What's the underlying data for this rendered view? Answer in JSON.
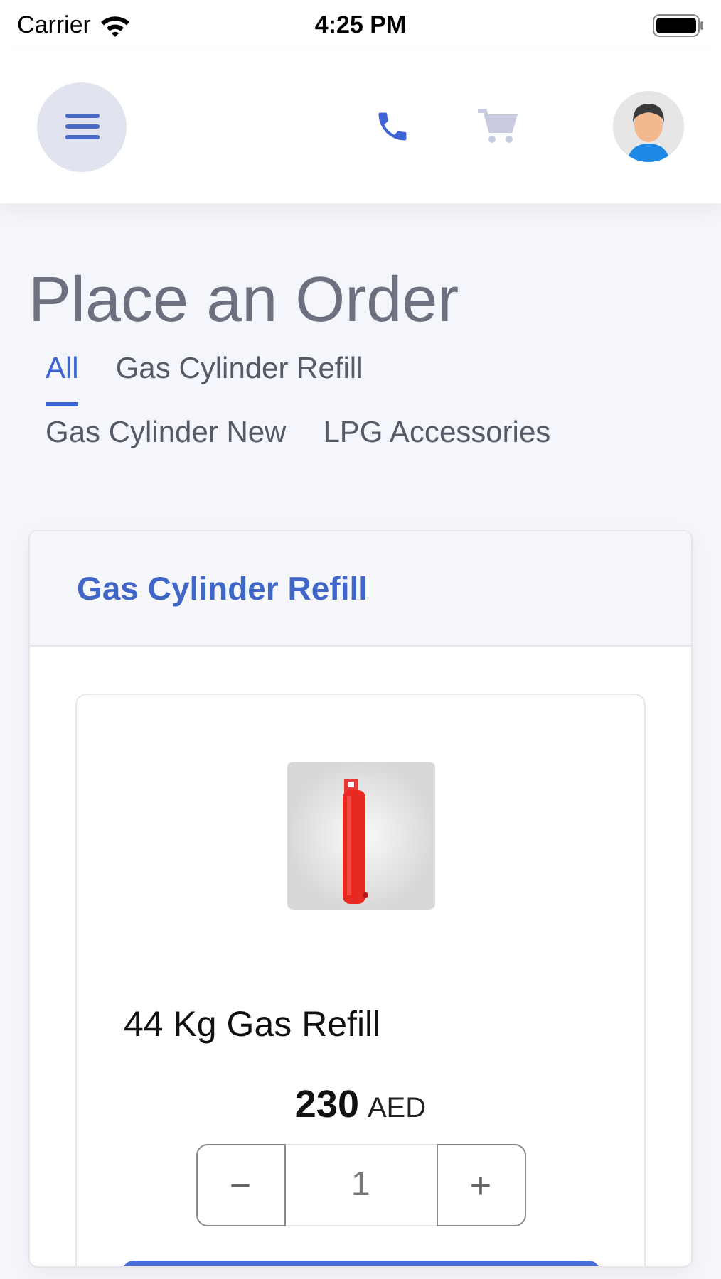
{
  "status_bar": {
    "carrier": "Carrier",
    "time": "4:25 PM"
  },
  "header": {
    "cart_enabled": false
  },
  "title": "Place an Order",
  "tabs": [
    {
      "label": "All",
      "selected": true
    },
    {
      "label": "Gas Cylinder Refill",
      "selected": false
    },
    {
      "label": "Gas Cylinder New",
      "selected": false
    },
    {
      "label": "LPG Accessories",
      "selected": false
    }
  ],
  "section": {
    "title": "Gas Cylinder Refill",
    "product": {
      "name": "44 Kg Gas Refill",
      "price": "230",
      "currency": "AED",
      "decrement": "−",
      "quantity": "1",
      "increment": "+"
    }
  }
}
